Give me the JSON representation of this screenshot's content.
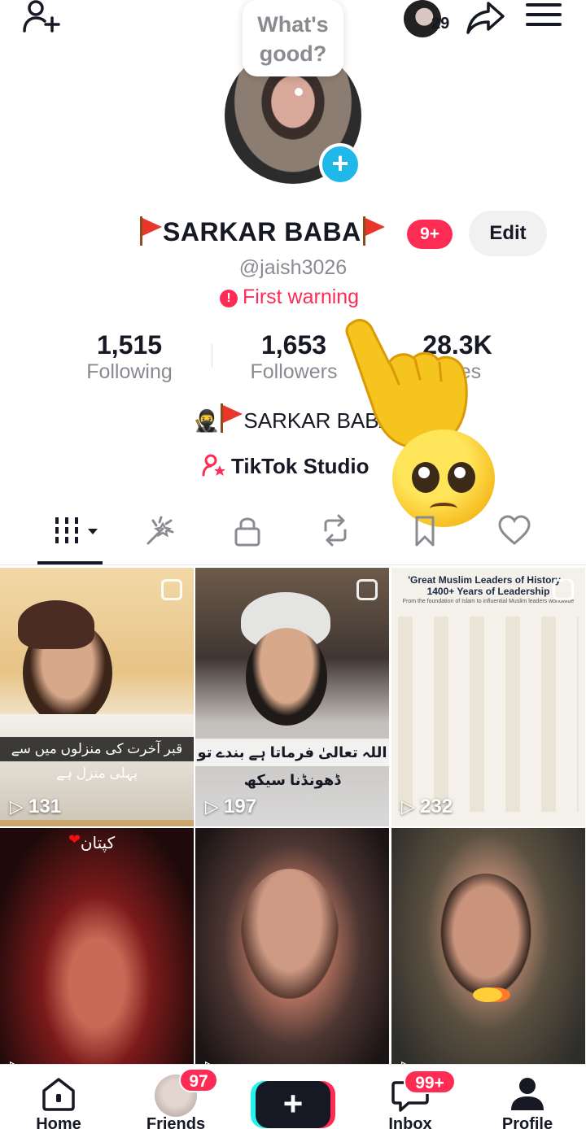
{
  "topbar": {
    "story_count": "29"
  },
  "bubble": {
    "text_line1": "What's",
    "text_line2": "good?"
  },
  "profile": {
    "name": "SARKAR BABA",
    "notification_badge": "9+",
    "edit_label": "Edit",
    "handle": "@jaish3026",
    "warning": "First warning",
    "bio": "SARKAR BABA",
    "studio_label": "TikTok Studio"
  },
  "stats": [
    {
      "value": "1,515",
      "label": "Following"
    },
    {
      "value": "1,653",
      "label": "Followers"
    },
    {
      "value": "28.3K",
      "label": "Likes"
    }
  ],
  "grid": [
    {
      "views": "131",
      "caption": "قبر آخرت کی منزلوں میں سے پہلی منزل ہے"
    },
    {
      "views": "197",
      "caption": "اللہ تعالیٰ فرماتا ہے بندے تو ڈھونڈنا سیکھ"
    },
    {
      "views": "232",
      "title": "'Great Muslim Leaders of History – 1400+ Years of Leadership",
      "subtitle": "From the foundation of Islam to influential Muslim leaders worldwide"
    },
    {
      "views": "",
      "caption": "کپتان"
    },
    {
      "views": ""
    },
    {
      "views": ""
    }
  ],
  "bottom_nav": {
    "home": "Home",
    "friends": "Friends",
    "friends_badge": "97",
    "create": "+",
    "inbox": "Inbox",
    "inbox_badge": "99+",
    "profile": "Profile"
  },
  "colors": {
    "accent": "#fe2c55",
    "cyan": "#25f4ee",
    "text": "#161823",
    "muted": "#8a8b91"
  }
}
